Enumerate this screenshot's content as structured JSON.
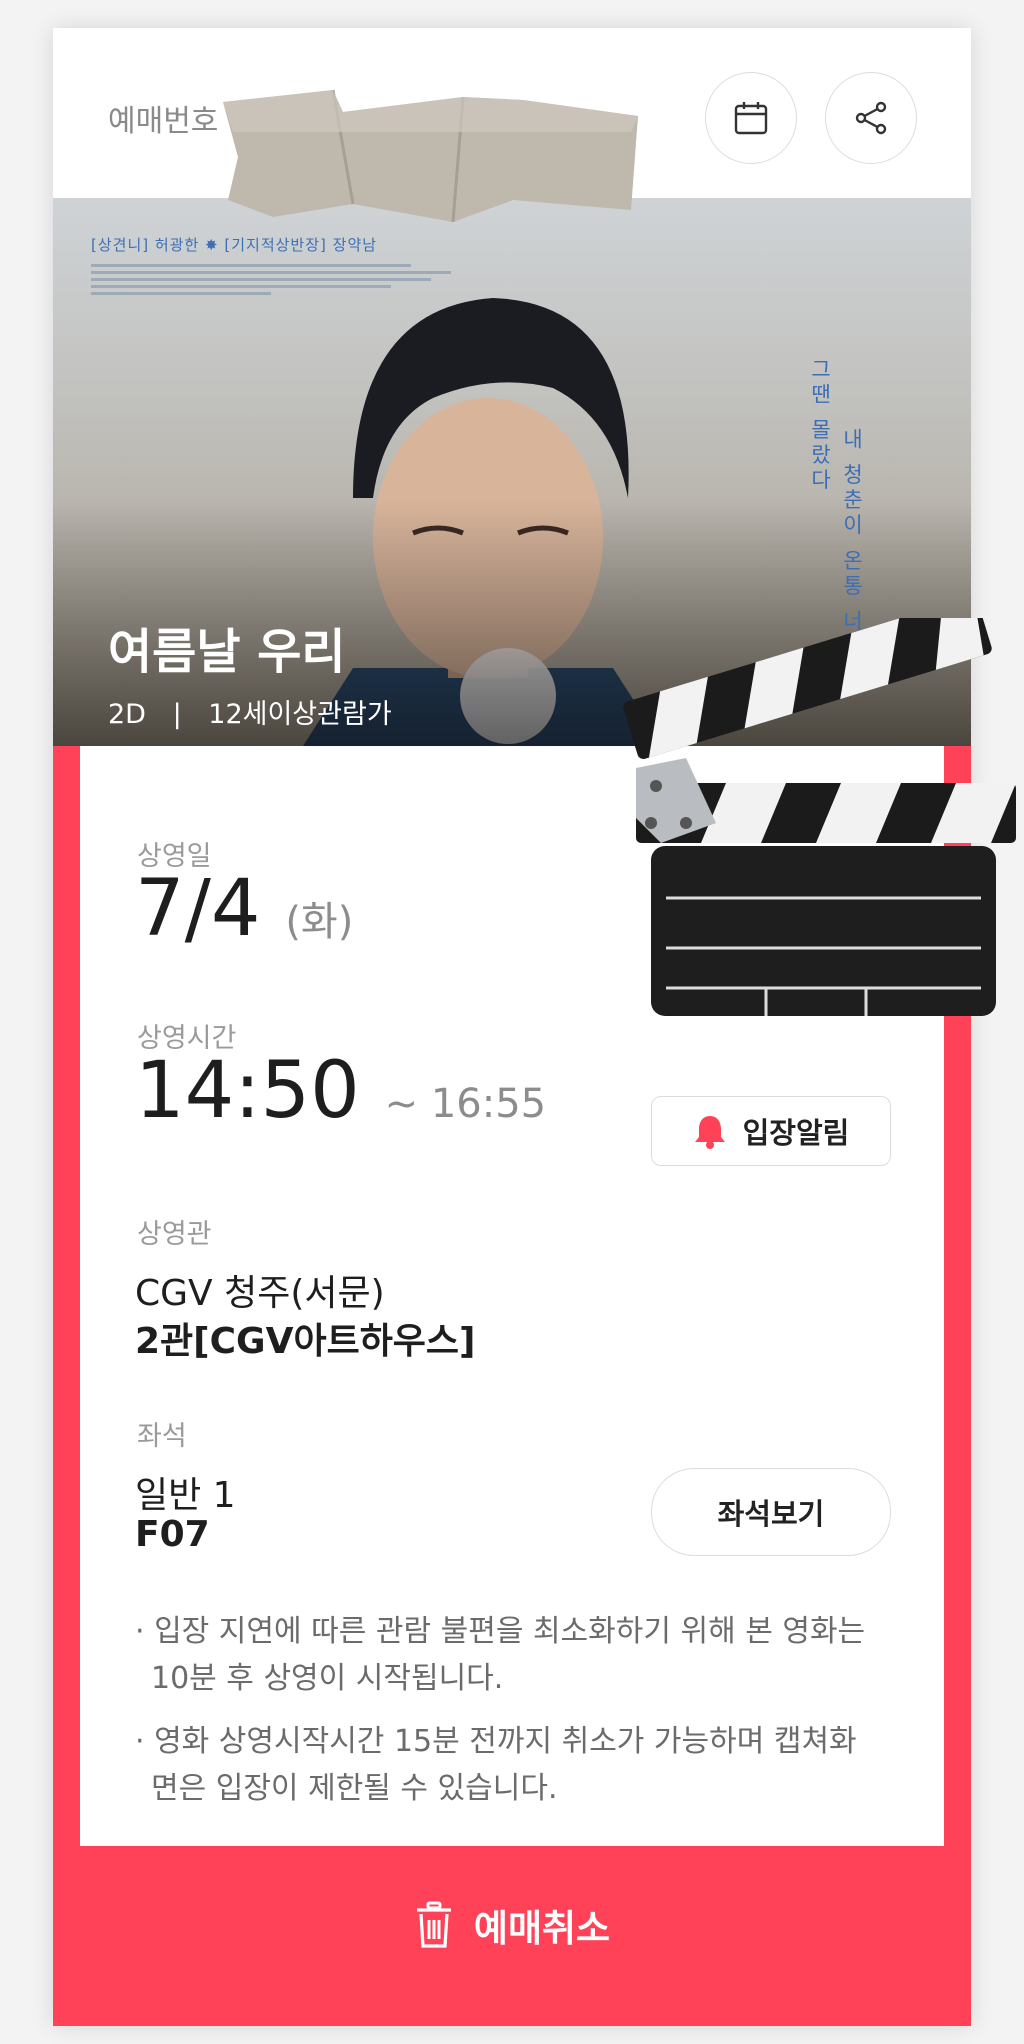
{
  "header": {
    "booking_label": "예매번호",
    "calendar_icon": "calendar-icon",
    "share_icon": "share-icon"
  },
  "poster": {
    "credit_line": "[상견니] 허광한 ✸ [기지적상반장] 장약남",
    "vertical_copy_1": "그땐 몰랐다",
    "vertical_copy_2": "내 청춘이 온통 너로 물",
    "movie_title": "여름날 우리",
    "format": "2D",
    "separator": "|",
    "rating": "12세이상관람가"
  },
  "details": {
    "date_label": "상영일",
    "date_value": "7/4",
    "date_weekday": "(화)",
    "time_label": "상영시간",
    "start_time": "14:50",
    "end_time": "~ 16:55",
    "alarm_button": "입장알림",
    "theater_label": "상영관",
    "theater_name": "CGV 청주(서문)",
    "screen_name": "2관[CGV아트하우스]",
    "seat_label": "좌석",
    "seat_type": "일반 1",
    "seat_number": "F07",
    "seat_button": "좌석보기"
  },
  "notes": [
    "· 입장 지연에 따른 관람 불편을 최소화하기 위해 본 영화는 10분 후 상영이 시작됩니다.",
    "· 영화 상영시작시간 15분 전까지 취소가 가능하며 캡쳐화면은 입장이 제한될 수 있습니다."
  ],
  "footer": {
    "cancel_label": "예매취소"
  },
  "colors": {
    "accent": "#ff4257",
    "label_gray": "#9a9a9a",
    "poster_text_blue": "#3b6eb6"
  }
}
